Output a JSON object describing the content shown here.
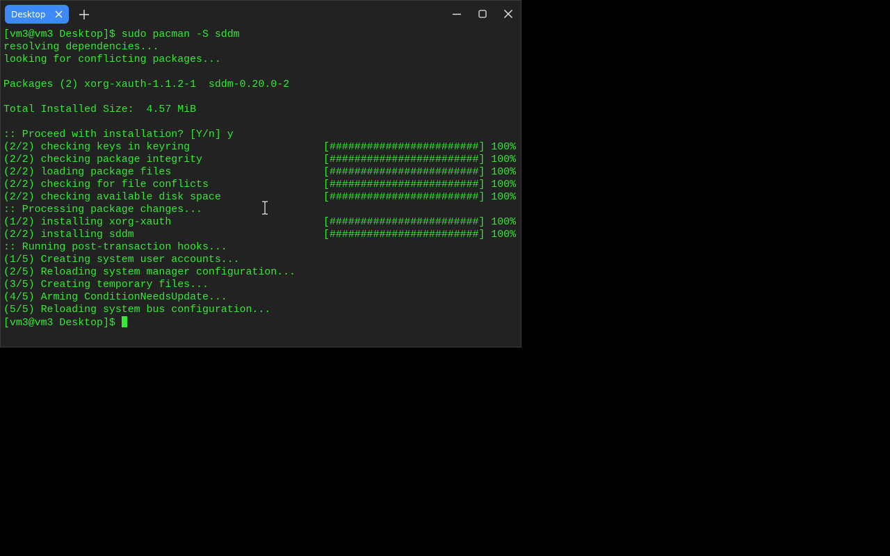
{
  "window": {
    "tab_label": "Desktop",
    "accent_color": "#3d8af7",
    "text_color": "#34e834",
    "icons": {
      "tab_close": "close-icon",
      "new_tab": "plus-icon",
      "minimize": "minimize-icon",
      "maximize": "maximize-icon",
      "close": "close-icon"
    }
  },
  "terminal": {
    "lines": [
      {
        "text": "[vm3@vm3 Desktop]$ sudo pacman -S sddm",
        "progress": ""
      },
      {
        "text": "resolving dependencies...",
        "progress": ""
      },
      {
        "text": "looking for conflicting packages...",
        "progress": ""
      },
      {
        "text": "",
        "progress": ""
      },
      {
        "text": "Packages (2) xorg-xauth-1.1.2-1  sddm-0.20.0-2",
        "progress": ""
      },
      {
        "text": "",
        "progress": ""
      },
      {
        "text": "Total Installed Size:  4.57 MiB",
        "progress": ""
      },
      {
        "text": "",
        "progress": ""
      },
      {
        "text": ":: Proceed with installation? [Y/n] y",
        "progress": ""
      },
      {
        "text": "(2/2) checking keys in keyring",
        "progress": "[########################] 100%"
      },
      {
        "text": "(2/2) checking package integrity",
        "progress": "[########################] 100%"
      },
      {
        "text": "(2/2) loading package files",
        "progress": "[########################] 100%"
      },
      {
        "text": "(2/2) checking for file conflicts",
        "progress": "[########################] 100%"
      },
      {
        "text": "(2/2) checking available disk space",
        "progress": "[########################] 100%"
      },
      {
        "text": ":: Processing package changes...",
        "progress": ""
      },
      {
        "text": "(1/2) installing xorg-xauth",
        "progress": "[########################] 100%"
      },
      {
        "text": "(2/2) installing sddm",
        "progress": "[########################] 100%"
      },
      {
        "text": ":: Running post-transaction hooks...",
        "progress": ""
      },
      {
        "text": "(1/5) Creating system user accounts...",
        "progress": ""
      },
      {
        "text": "(2/5) Reloading system manager configuration...",
        "progress": ""
      },
      {
        "text": "(3/5) Creating temporary files...",
        "progress": ""
      },
      {
        "text": "(4/5) Arming ConditionNeedsUpdate...",
        "progress": ""
      },
      {
        "text": "(5/5) Reloading system bus configuration...",
        "progress": ""
      }
    ],
    "prompt": "[vm3@vm3 Desktop]$ "
  }
}
